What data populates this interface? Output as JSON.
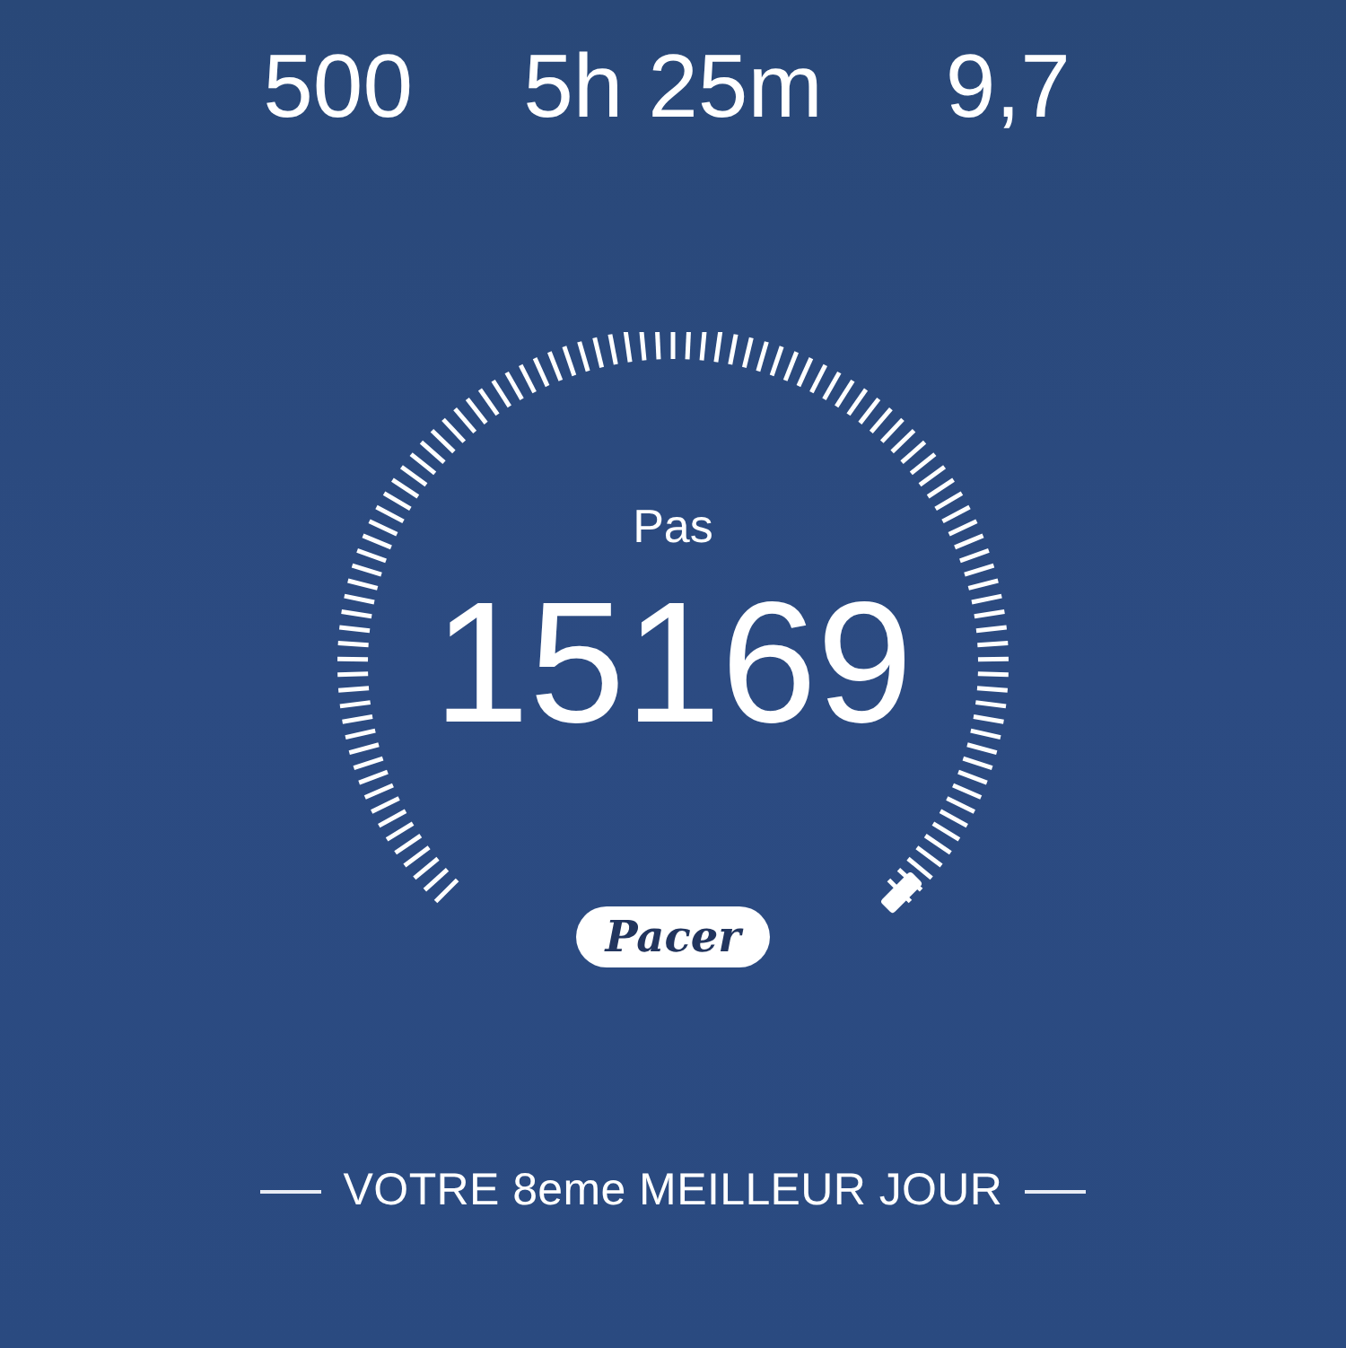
{
  "stats": [
    {
      "value": "500"
    },
    {
      "value": "5h 25m"
    },
    {
      "value": "9,7"
    }
  ],
  "gauge": {
    "label": "Pas",
    "value": "15169",
    "badge": "Pacer"
  },
  "footer": {
    "text": "VOTRE 8eme MEILLEUR JOUR"
  }
}
